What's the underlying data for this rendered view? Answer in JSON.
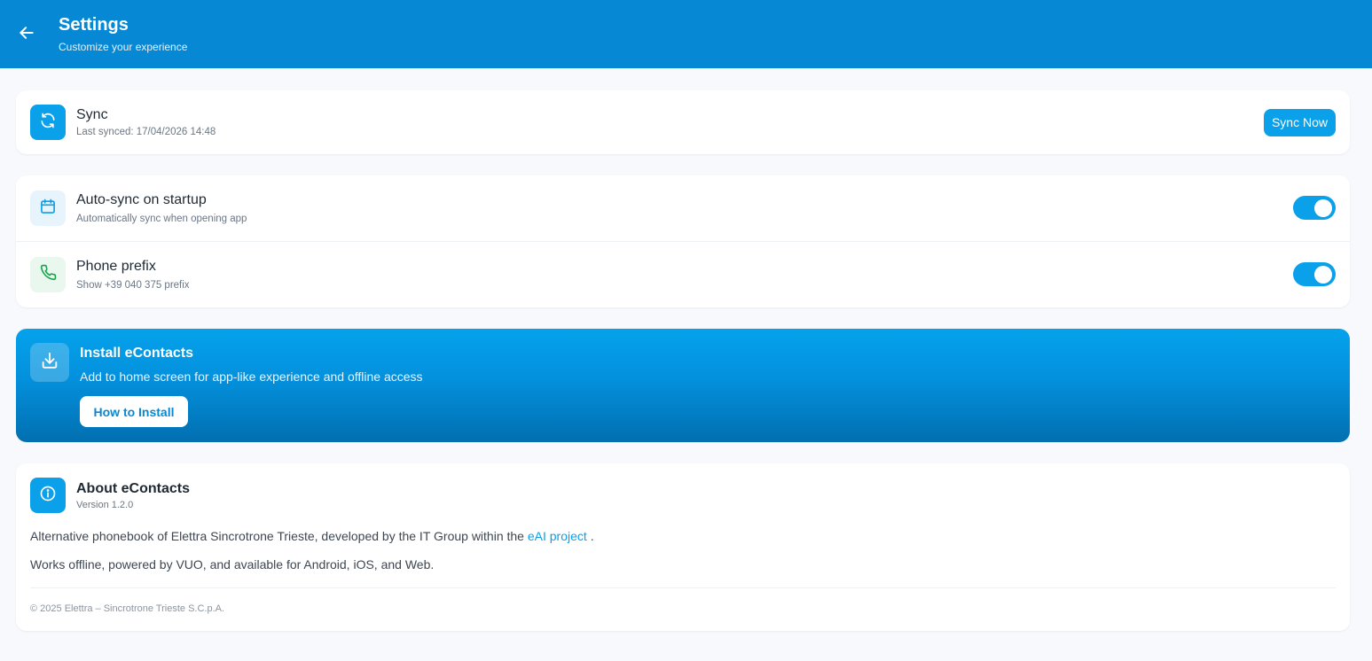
{
  "header": {
    "title": "Settings",
    "subtitle": "Customize your experience",
    "back_icon": "arrow-left-icon"
  },
  "sync": {
    "title": "Sync",
    "last_synced": "Last synced: 17/04/2026 14:48",
    "button_label": "Sync Now",
    "icon": "refresh-icon"
  },
  "preferences": [
    {
      "title": "Auto-sync on startup",
      "subtitle": "Automatically sync when opening app",
      "enabled": true,
      "icon": "calendar-icon"
    },
    {
      "title": "Phone prefix",
      "subtitle": "Show +39 040 375 prefix",
      "enabled": true,
      "icon": "phone-icon"
    }
  ],
  "install": {
    "title": "Install eContacts",
    "subtitle": "Add to home screen for app-like experience and offline access",
    "button_label": "How to Install",
    "icon": "download-icon"
  },
  "about": {
    "title": "About eContacts",
    "version": "Version 1.2.0",
    "description_prefix": "Alternative phonebook of Elettra Sincrotrone Trieste, developed by the IT Group within the",
    "link_label": "eAI project",
    "description_suffix": ".",
    "line2": "Works offline, powered by VUO, and available for Android, iOS, and Web.",
    "copyright": "© 2025 Elettra – Sincrotrone Trieste S.C.p.A.",
    "icon": "info-icon"
  },
  "colors": {
    "header": "#0788d4",
    "accent": "#0aa0ea",
    "phone_icon": "#16a34a"
  }
}
